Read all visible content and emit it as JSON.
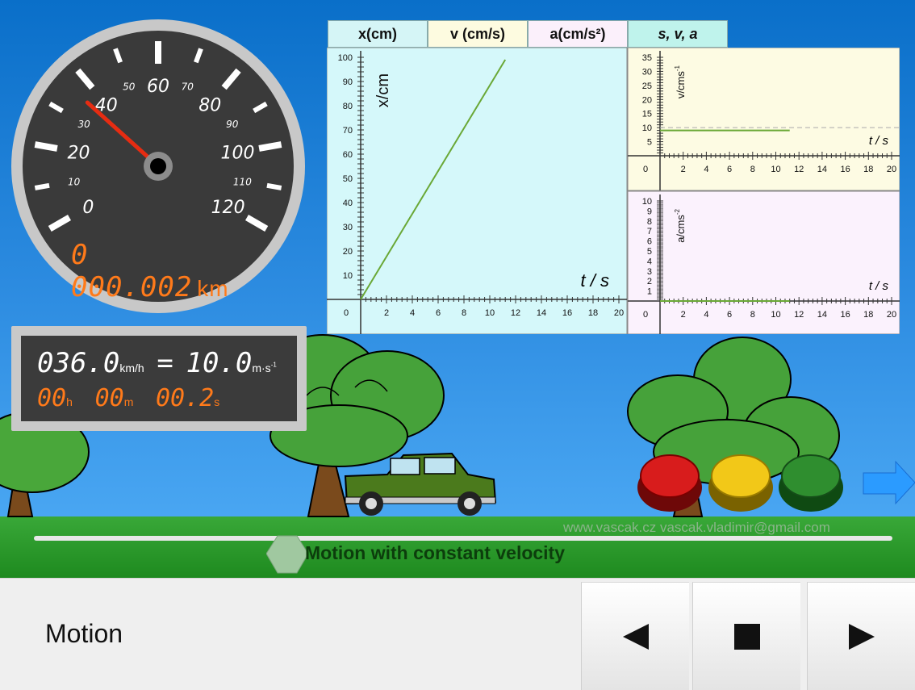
{
  "speedometer": {
    "major_labels": [
      "0",
      "20",
      "40",
      "60",
      "80",
      "100",
      "120"
    ],
    "minor_labels": [
      "10",
      "30",
      "50",
      "70",
      "90",
      "110"
    ],
    "odometer": "0 000.002",
    "odometer_unit": "km",
    "speed_kmh": 36
  },
  "readout": {
    "speed_kmh": "036.0",
    "unit_kmh": "km/h",
    "equals": "=",
    "speed_ms": "10.0",
    "unit_ms": "m·s",
    "unit_ms_exp": "-1",
    "hours": "00",
    "hours_unit": "h",
    "minutes": "00",
    "minutes_unit": "m",
    "seconds": "00.2",
    "seconds_unit": "s"
  },
  "tabs": [
    {
      "label": "x(cm)",
      "color": "#d5f5f6"
    },
    {
      "label": "v (cm/s)",
      "color": "#fdfbe0"
    },
    {
      "label": "a(cm/s²)",
      "color": "#fbf0fb"
    },
    {
      "label": "s, v, a",
      "color": "#bff3ec"
    }
  ],
  "colors": {
    "graph_x_bg": "#d5f8fa",
    "graph_v_bg": "#fdfbe3",
    "graph_a_bg": "#fbf2fd",
    "plot_line": "#6aa836",
    "sky": "#1f80d8",
    "grass": "#2f9a2f",
    "odometer": "#ff7a1a"
  },
  "chart_data": [
    {
      "type": "line",
      "title": "",
      "xlabel": "t / s",
      "ylabel": "x/cm",
      "xlim": [
        0,
        20
      ],
      "ylim": [
        0,
        100
      ],
      "x_ticks": [
        "2",
        "4",
        "6",
        "8",
        "10",
        "12",
        "14",
        "16",
        "18",
        "20"
      ],
      "y_ticks": [
        "10",
        "20",
        "30",
        "40",
        "50",
        "60",
        "70",
        "80",
        "90",
        "100"
      ],
      "series": [
        {
          "x": [
            0,
            11.2
          ],
          "y": [
            0,
            99
          ]
        }
      ]
    },
    {
      "type": "line",
      "title": "",
      "xlabel": "t / s",
      "ylabel": "v/cms",
      "ylabel_exp": "-1",
      "xlim": [
        0,
        20
      ],
      "ylim": [
        0,
        35
      ],
      "x_ticks": [
        "2",
        "4",
        "6",
        "8",
        "10",
        "12",
        "14",
        "16",
        "18",
        "20"
      ],
      "y_ticks": [
        "5",
        "10",
        "15",
        "20",
        "25",
        "30",
        "35"
      ],
      "reference_line_y": 10,
      "series": [
        {
          "x": [
            0,
            11.2
          ],
          "y": [
            9,
            9
          ]
        }
      ]
    },
    {
      "type": "line",
      "title": "",
      "xlabel": "t / s",
      "ylabel": "a/cms",
      "ylabel_exp": "-2",
      "xlim": [
        0,
        20
      ],
      "ylim": [
        0,
        10
      ],
      "x_ticks": [
        "2",
        "4",
        "6",
        "8",
        "10",
        "12",
        "14",
        "16",
        "18",
        "20"
      ],
      "y_ticks": [
        "1",
        "2",
        "3",
        "4",
        "5",
        "6",
        "7",
        "8",
        "9",
        "10"
      ],
      "series": [
        {
          "x": [
            0,
            11.2
          ],
          "y": [
            0,
            0
          ]
        }
      ]
    }
  ],
  "axis_origin": "0",
  "slider": {
    "label": "Motion with constant velocity",
    "position": 0.3
  },
  "watermark": "www.vascak.cz        vascak.vladimir@gmail.com",
  "bottom_bar": {
    "title": "Motion"
  }
}
